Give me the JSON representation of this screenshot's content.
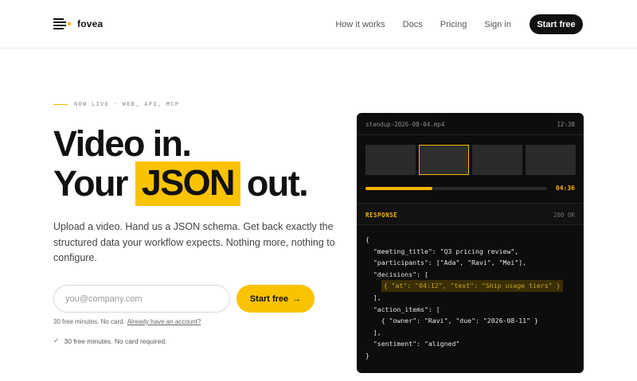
{
  "brand": {
    "name": "fovea",
    "accent": "#f9c300"
  },
  "nav": {
    "items": [
      "How it works",
      "Docs",
      "Pricing",
      "Sign in"
    ],
    "cta": "Start free"
  },
  "eyebrow": "NOW LIVE · WEB, API, MCP",
  "hero": {
    "line1": "Video in.",
    "line2_before": "Your",
    "line2_highlight": "JSON",
    "line2_after": "out."
  },
  "lede": "Upload a video. Hand us a JSON schema. Get back exactly the structured data your workflow expects. Nothing more, nothing to configure.",
  "signup": {
    "email_placeholder": "you@company.com",
    "button_label": "Start free",
    "button_icon": "arrow-right-icon",
    "fine_print": "30 free minutes. No card.",
    "fine_print_link": "Already have an account?",
    "check_text": "30 free minutes. No card required."
  },
  "demo": {
    "file_name": "standup-2026-08-04.mp4",
    "duration": "12:38",
    "progress": 0.37,
    "progress_time": "04:36",
    "response_label": "RESPONSE",
    "response_status": "200 OK",
    "code_lines": [
      "{",
      "  \"meeting_title\": \"Q3 pricing review\",",
      "  \"participants\": [\"Ada\", \"Ravi\", \"Mei\"],",
      "  \"decisions\": [",
      "    { \"at\": \"04:12\", \"text\": \"Ship usage tiers\" }",
      "  ],",
      "  \"action_items\": [",
      "    { \"owner\": \"Ravi\", \"due\": \"2026-08-11\" }",
      "  ],",
      "  \"sentiment\": \"aligned\"",
      "}"
    ],
    "highlight_line": 4
  }
}
